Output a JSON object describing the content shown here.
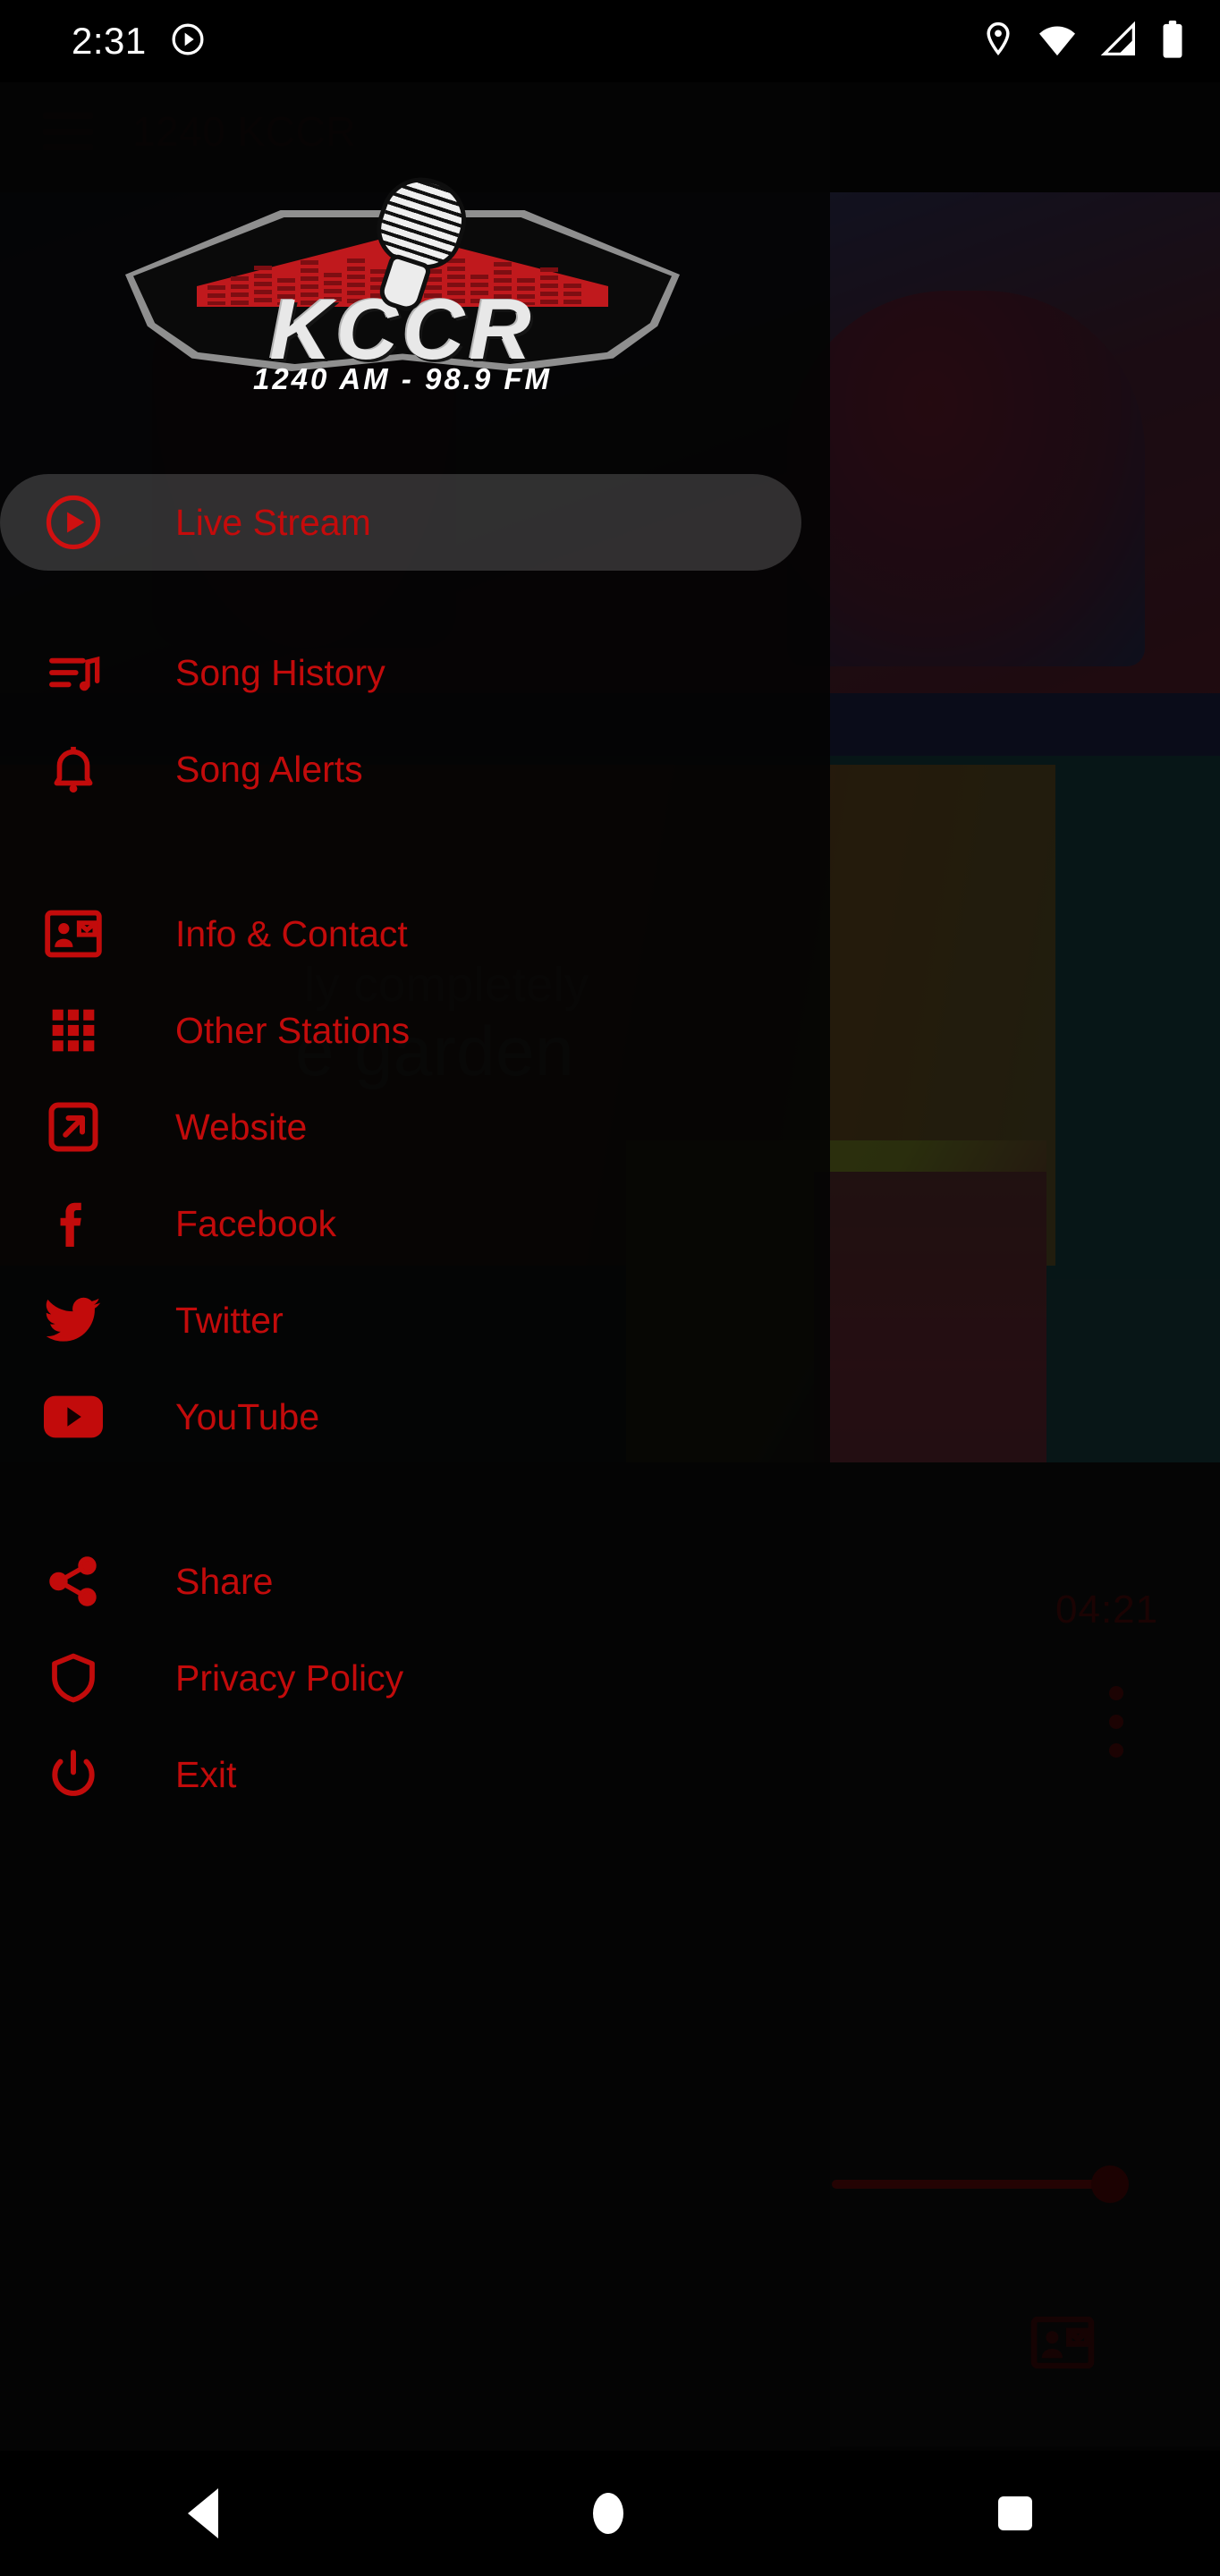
{
  "status_bar": {
    "clock": "2:31",
    "left_icons": [
      "play-circle-icon"
    ],
    "right_icons": [
      "location-pin-icon",
      "wifi-icon",
      "cellular-signal-icon",
      "battery-icon"
    ]
  },
  "app_background": {
    "appbar": {
      "menu_icon": "hamburger-icon",
      "title": "1240 KCCR"
    },
    "album_art": {
      "line1": "ly completely",
      "line2": "e garden"
    },
    "player": {
      "elapsed_time": "04:21",
      "overflow_icon": "kebab-menu-icon",
      "volume_slider_value": 100,
      "contact_icon": "contact-card-icon"
    }
  },
  "drawer": {
    "logo": {
      "callsign": "KCCR",
      "frequency": "1240 AM - 98.9 FM",
      "icon": "microphone-icon"
    },
    "items": [
      {
        "id": "live-stream",
        "label": "Live Stream",
        "icon": "play-circle-icon",
        "active": true,
        "gap_after": "small"
      },
      {
        "id": "song-history",
        "label": "Song History",
        "icon": "playlist-music-icon",
        "active": false,
        "gap_after": "none"
      },
      {
        "id": "song-alerts",
        "label": "Song Alerts",
        "icon": "bell-icon",
        "active": false,
        "gap_after": "medium"
      },
      {
        "id": "info-contact",
        "label": "Info & Contact",
        "icon": "contact-card-icon",
        "active": false,
        "gap_after": "none"
      },
      {
        "id": "other-stations",
        "label": "Other Stations",
        "icon": "grid-apps-icon",
        "active": false,
        "gap_after": "none"
      },
      {
        "id": "website",
        "label": "Website",
        "icon": "external-link-icon",
        "active": false,
        "gap_after": "none"
      },
      {
        "id": "facebook",
        "label": "Facebook",
        "icon": "facebook-icon",
        "active": false,
        "gap_after": "none"
      },
      {
        "id": "twitter",
        "label": "Twitter",
        "icon": "twitter-icon",
        "active": false,
        "gap_after": "none"
      },
      {
        "id": "youtube",
        "label": "YouTube",
        "icon": "youtube-icon",
        "active": false,
        "gap_after": "medium"
      },
      {
        "id": "share",
        "label": "Share",
        "icon": "share-nodes-icon",
        "active": false,
        "gap_after": "none"
      },
      {
        "id": "privacy-policy",
        "label": "Privacy Policy",
        "icon": "shield-icon",
        "active": false,
        "gap_after": "none"
      },
      {
        "id": "exit",
        "label": "Exit",
        "icon": "power-icon",
        "active": false,
        "gap_after": "none"
      }
    ]
  },
  "nav_bar": {
    "back": "back-triangle-icon",
    "home": "home-circle-icon",
    "recents": "recents-square-icon"
  },
  "colors": {
    "accent_red": "#c20b0b",
    "logo_red": "#c0191d",
    "drawer_bg": "#040404",
    "highlight": "rgba(150,150,150,0.30)"
  }
}
